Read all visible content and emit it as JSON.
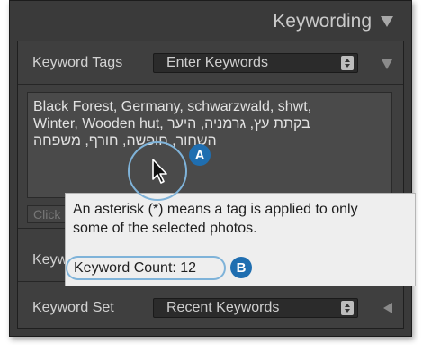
{
  "panel": {
    "title": "Keywording"
  },
  "keyword_tags": {
    "label": "Keyword Tags",
    "selected": "Enter Keywords"
  },
  "keywords_text": {
    "line1": "Black Forest, Germany, schwarzwald, shwt,",
    "line2_ltr": "Winter, Wooden hut,",
    "line2_rtl": "בקתת עץ, גרמניה, היער",
    "line3_rtl": "השחור, חופשה, חורף, משפחה"
  },
  "click_here_partial": "Click",
  "keyword_suggestions_partial": "Keyw",
  "keyword_set": {
    "label": "Keyword Set",
    "selected": "Recent Keywords"
  },
  "tooltip": {
    "line1": "An asterisk (*) means a tag is applied to only",
    "line2": "some of the selected photos.",
    "count": "Keyword Count: 12"
  },
  "callouts": {
    "a": "A",
    "b": "B"
  },
  "colors": {
    "callout_ring": "#7fb3d9",
    "badge": "#1f6eb0"
  },
  "icons": [
    "disclosure-triangle-down",
    "stepper-arrows",
    "mouse-cursor",
    "disclosure-triangle-left"
  ]
}
